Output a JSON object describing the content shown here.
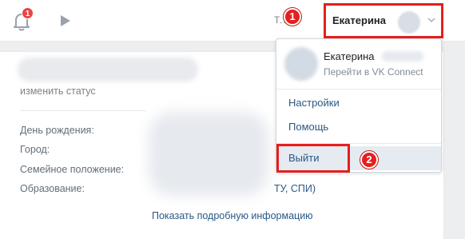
{
  "topbar": {
    "notifications_count": "1",
    "tf_text": "Т...",
    "user_name": "Екатерина"
  },
  "dropdown": {
    "name": "Екатерина",
    "subtitle": "Перейти в VK Connect",
    "items": [
      {
        "label": "Настройки"
      },
      {
        "label": "Помощь"
      },
      {
        "label": "Выйти"
      }
    ]
  },
  "profile": {
    "status_link": "изменить статус",
    "labels": {
      "birthday": "День рождения:",
      "city": "Город:",
      "family": "Семейное положение:",
      "education": "Образование:"
    },
    "education_value": "ТУ, СПИ)",
    "more_info": "Показать подробную информацию"
  },
  "annotations": {
    "step1": "1",
    "step2": "2",
    "highlight_color": "#e61e1e"
  },
  "colors": {
    "link": "#2a5885",
    "background": "#edeef0",
    "badge": "#e64646"
  }
}
